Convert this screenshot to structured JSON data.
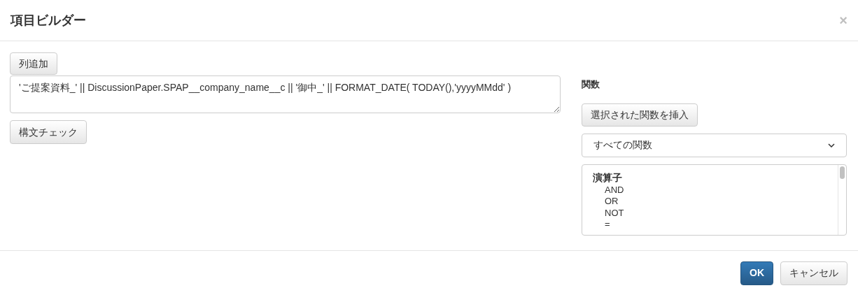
{
  "dialog": {
    "title": "項目ビルダー",
    "close": "×"
  },
  "editor": {
    "add_column_button": "列追加",
    "expression": "'ご提案資料_' || DiscussionPaper.SPAP__company_name__c || '御中_' || FORMAT_DATE( TODAY(),'yyyyMMdd' )",
    "syntax_check_button": "構文チェック"
  },
  "functions": {
    "heading": "関数",
    "insert_button": "選択された関数を挿入",
    "category_select": "すべての関数",
    "list": [
      {
        "group": "演算子",
        "items": [
          "AND",
          "OR",
          "NOT",
          "="
        ]
      }
    ]
  },
  "footer": {
    "buttons": [
      {
        "label": "OK",
        "kind": "primary"
      },
      {
        "label": "キャンセル",
        "kind": "default"
      }
    ]
  }
}
